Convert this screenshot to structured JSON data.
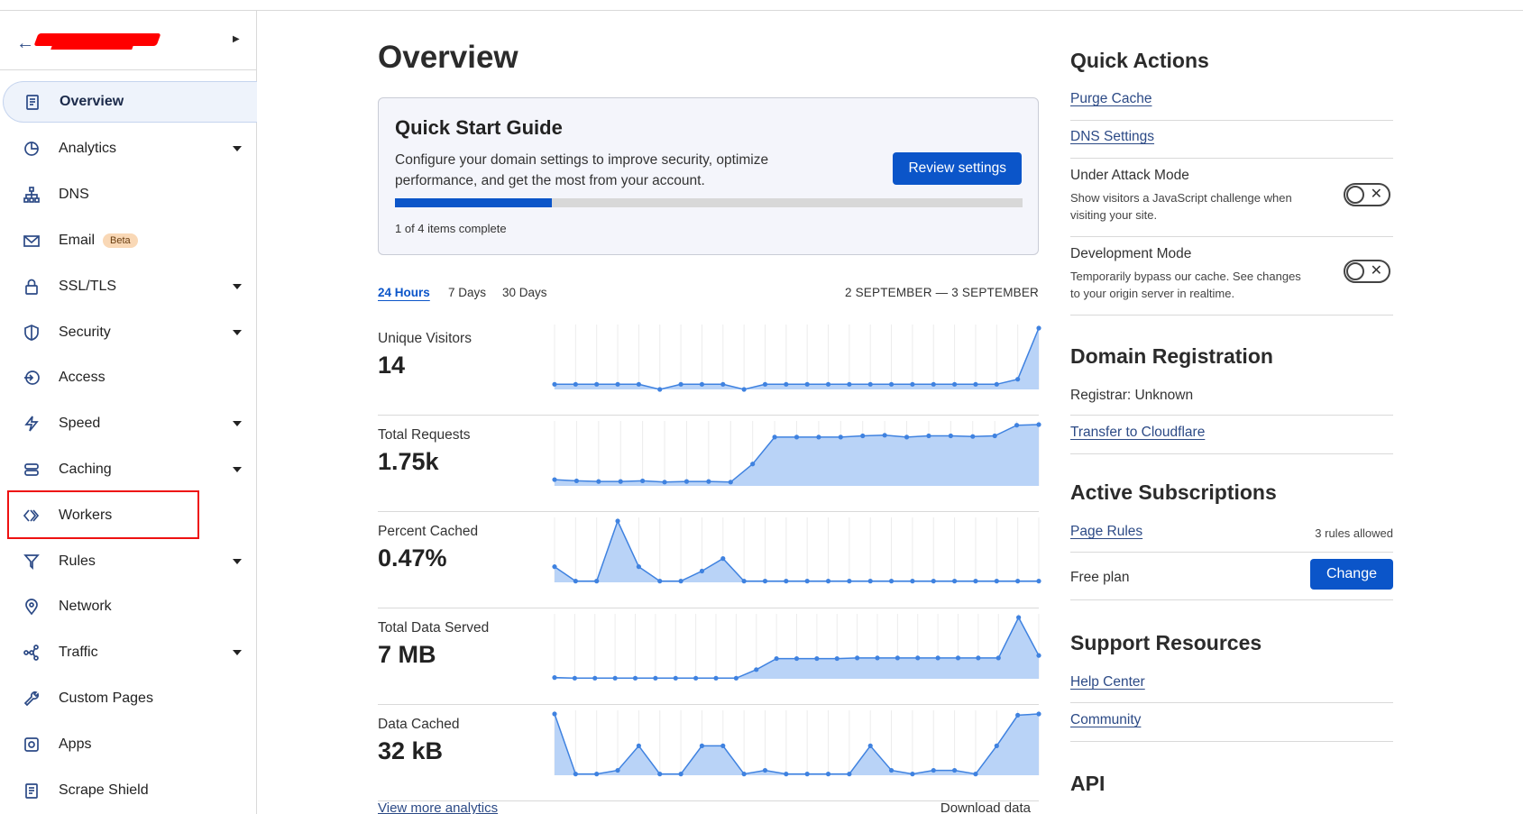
{
  "sidebar": {
    "items": [
      {
        "label": "Overview",
        "icon": "document-icon",
        "active": true,
        "caret": false
      },
      {
        "label": "Analytics",
        "icon": "pie-chart-icon",
        "caret": true
      },
      {
        "label": "DNS",
        "icon": "network-tree-icon",
        "caret": false
      },
      {
        "label": "Email",
        "icon": "envelope-icon",
        "caret": false,
        "badge": "Beta"
      },
      {
        "label": "SSL/TLS",
        "icon": "lock-icon",
        "caret": true
      },
      {
        "label": "Security",
        "icon": "shield-icon",
        "caret": true
      },
      {
        "label": "Access",
        "icon": "access-icon",
        "caret": false
      },
      {
        "label": "Speed",
        "icon": "lightning-icon",
        "caret": true
      },
      {
        "label": "Caching",
        "icon": "storage-icon",
        "caret": true
      },
      {
        "label": "Workers",
        "icon": "workers-icon",
        "caret": false
      },
      {
        "label": "Rules",
        "icon": "funnel-icon",
        "caret": true
      },
      {
        "label": "Network",
        "icon": "location-pin-icon",
        "caret": false
      },
      {
        "label": "Traffic",
        "icon": "share-nodes-icon",
        "caret": true
      },
      {
        "label": "Custom Pages",
        "icon": "wrench-icon",
        "caret": false
      },
      {
        "label": "Apps",
        "icon": "apps-icon",
        "caret": false
      },
      {
        "label": "Scrape Shield",
        "icon": "document-icon",
        "caret": false
      }
    ]
  },
  "main": {
    "title": "Overview",
    "quick_start": {
      "title": "Quick Start Guide",
      "description": "Configure your domain settings to improve security, optimize performance, and get the most from your account.",
      "button": "Review settings",
      "progress": 0.25,
      "status": "1 of 4 items complete"
    },
    "tabs": [
      "24 Hours",
      "7 Days",
      "30 Days"
    ],
    "range": "2 SEPTEMBER — 3 SEPTEMBER",
    "metrics": [
      {
        "label": "Unique Visitors",
        "value": "14"
      },
      {
        "label": "Total Requests",
        "value": "1.75k"
      },
      {
        "label": "Percent Cached",
        "value": "0.47%"
      },
      {
        "label": "Total Data Served",
        "value": "7 MB"
      },
      {
        "label": "Data Cached",
        "value": "32 kB"
      }
    ],
    "view_more": "View more analytics",
    "download": "Download data"
  },
  "chart_data": [
    {
      "type": "area",
      "title": "Unique Visitors",
      "values": [
        1,
        1,
        1,
        1,
        1,
        0,
        1,
        1,
        1,
        0,
        1,
        1,
        1,
        1,
        1,
        1,
        1,
        1,
        1,
        1,
        1,
        1,
        2,
        12
      ]
    },
    {
      "type": "area",
      "title": "Total Requests",
      "values": [
        10,
        8,
        7,
        7,
        8,
        6,
        7,
        7,
        6,
        35,
        78,
        78,
        78,
        78,
        80,
        81,
        78,
        80,
        80,
        79,
        80,
        97,
        98
      ]
    },
    {
      "type": "area",
      "title": "Percent Cached",
      "values": [
        25,
        2,
        2,
        98,
        25,
        2,
        2,
        18,
        38,
        2,
        2,
        2,
        2,
        2,
        2,
        2,
        2,
        2,
        2,
        2,
        2,
        2,
        2,
        2
      ]
    },
    {
      "type": "area",
      "title": "Total Data Served",
      "values": [
        2,
        1,
        1,
        1,
        1,
        1,
        1,
        1,
        1,
        1,
        15,
        33,
        33,
        33,
        33,
        34,
        34,
        34,
        34,
        34,
        34,
        34,
        34,
        100,
        38
      ]
    },
    {
      "type": "area",
      "title": "Data Cached",
      "values": [
        100,
        2,
        2,
        8,
        48,
        2,
        2,
        48,
        48,
        2,
        8,
        2,
        2,
        2,
        2,
        48,
        8,
        2,
        8,
        8,
        2,
        48,
        98,
        100
      ]
    }
  ],
  "right": {
    "quick_actions": {
      "title": "Quick Actions",
      "purge": "Purge Cache",
      "dns": "DNS Settings",
      "under_attack": {
        "title": "Under Attack Mode",
        "desc": "Show visitors a JavaScript challenge when visiting your site.",
        "on": false
      },
      "dev_mode": {
        "title": "Development Mode",
        "desc": "Temporarily bypass our cache. See changes to your origin server in realtime.",
        "on": false
      }
    },
    "domain_registration": {
      "title": "Domain Registration",
      "registrar": "Registrar: Unknown",
      "transfer": "Transfer to Cloudflare"
    },
    "subscriptions": {
      "title": "Active Subscriptions",
      "page_rules": "Page Rules",
      "rules_note": "3 rules allowed",
      "plan": "Free plan",
      "change": "Change"
    },
    "support": {
      "title": "Support Resources",
      "help": "Help Center",
      "community": "Community"
    },
    "api_title": "API"
  },
  "colors": {
    "accent": "#0b55c9",
    "chart_fill": "#b9d3f7",
    "chart_line": "#3f82e0",
    "sidebar_icon": "#2c4a86",
    "highlight": "#e11111"
  }
}
